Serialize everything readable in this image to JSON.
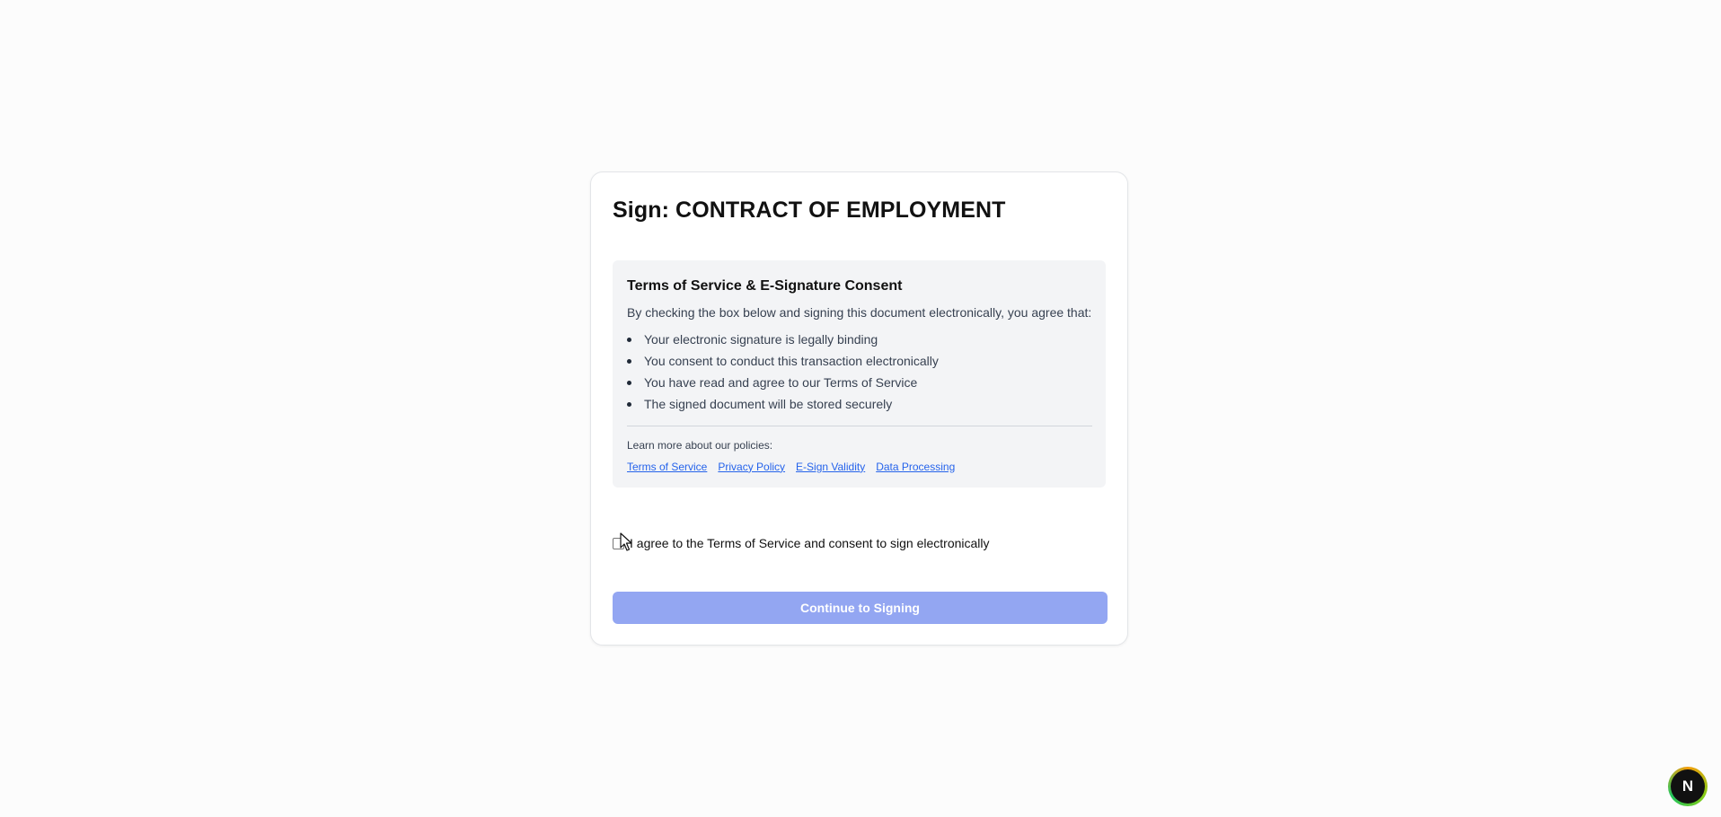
{
  "card": {
    "title": "Sign: CONTRACT OF EMPLOYMENT"
  },
  "consent": {
    "heading": "Terms of Service & E-Signature Consent",
    "intro": "By checking the box below and signing this document electronically, you agree that:",
    "items": [
      "Your electronic signature is legally binding",
      "You consent to conduct this transaction electronically",
      "You have read and agree to our Terms of Service",
      "The signed document will be stored securely"
    ],
    "policies_label": "Learn more about our policies:",
    "links": [
      "Terms of Service",
      "Privacy Policy",
      "E-Sign Validity",
      "Data Processing"
    ]
  },
  "agreement": {
    "label": "I agree to the Terms of Service and consent to sign electronically",
    "checked": false
  },
  "actions": {
    "continue_label": "Continue to Signing"
  },
  "badge": {
    "letter": "N",
    "icon": "nextjs-dev-indicator-icon"
  },
  "colors": {
    "accent_disabled": "#93a6f2",
    "link": "#2563eb",
    "panel_bg": "#f3f4f6"
  }
}
